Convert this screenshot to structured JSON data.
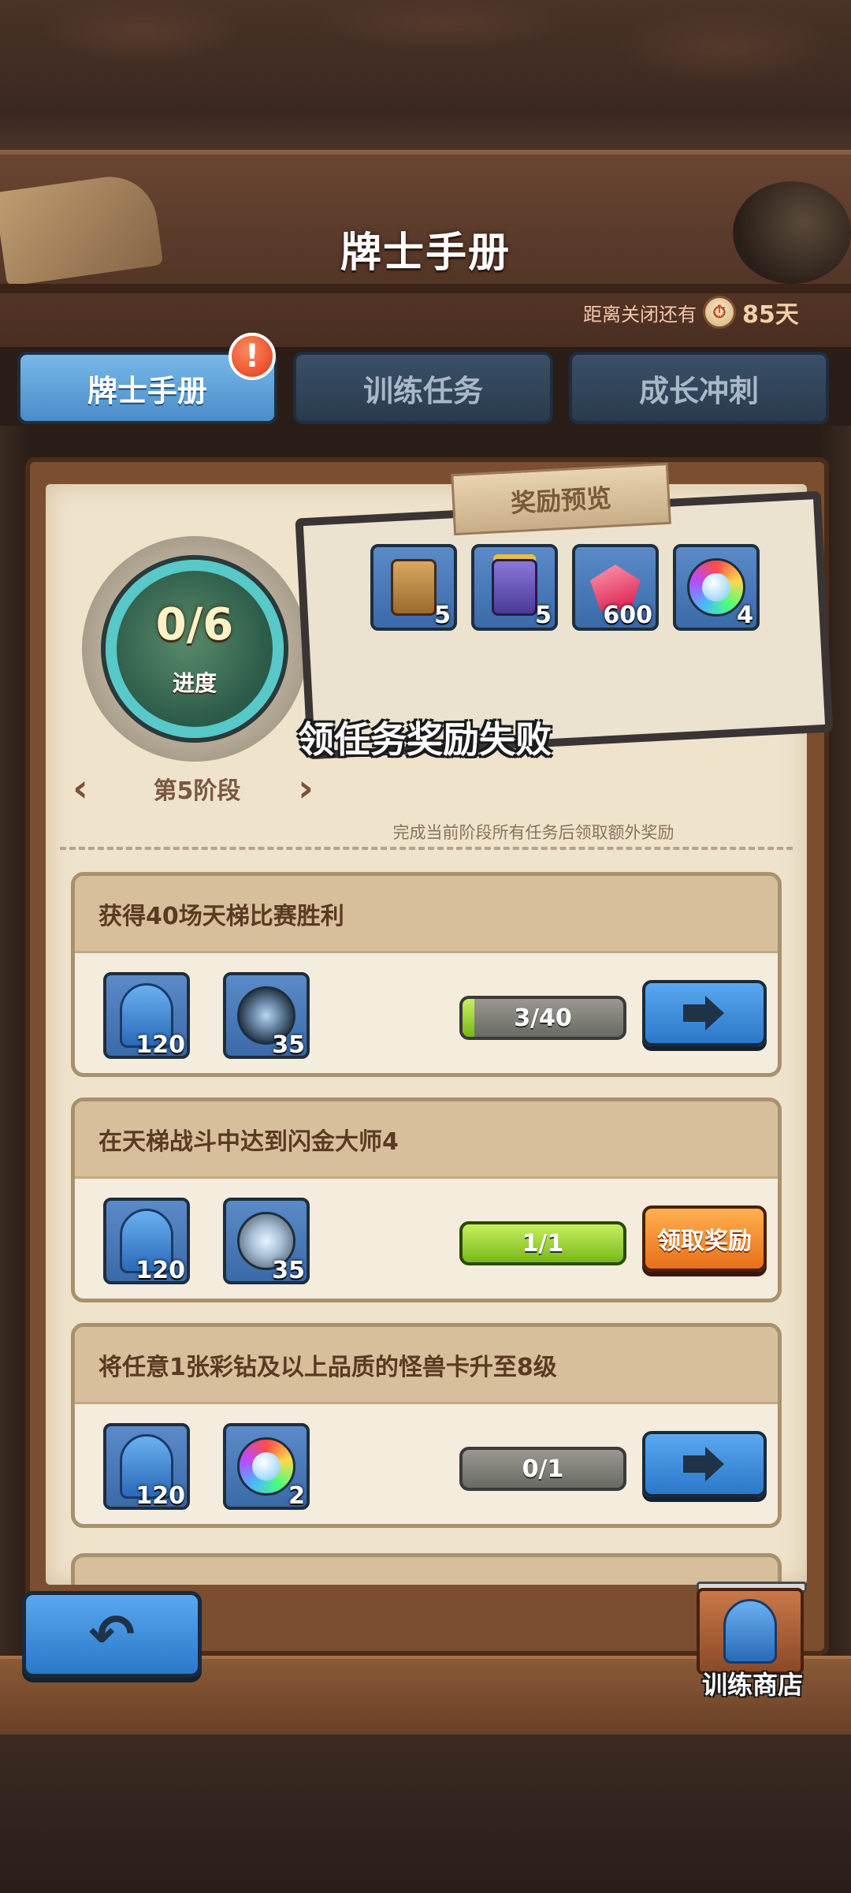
{
  "header": {
    "title": "牌士手册",
    "countdown_label": "距离关闭还有",
    "countdown_value": "85天"
  },
  "tabs": [
    {
      "label": "牌士手册",
      "active": true,
      "alert": "!"
    },
    {
      "label": "训练任务",
      "active": false
    },
    {
      "label": "成长冲刺",
      "active": false
    }
  ],
  "stage": {
    "progress": "0/6",
    "progress_label": "进度",
    "stage_label": "第5阶段",
    "prev_icon": "chevron-left-icon",
    "next_icon": "chevron-right-icon"
  },
  "reward_preview": {
    "title": "奖励预览",
    "items": [
      {
        "icon": "gold-chest-icon",
        "qty": "5"
      },
      {
        "icon": "purple-chest-icon",
        "qty": "5"
      },
      {
        "icon": "red-gem-icon",
        "qty": "600"
      },
      {
        "icon": "rainbow-orb-icon",
        "qty": "4"
      }
    ],
    "toast": "领任务奖励失败",
    "note": "完成当前阶段所有任务后领取额外奖励"
  },
  "tasks": [
    {
      "title": "获得40场天梯比赛胜利",
      "rewards": [
        {
          "icon": "hero-token-icon",
          "qty": "120"
        },
        {
          "icon": "dark-orb-icon",
          "qty": "35"
        }
      ],
      "progress_text": "3/40",
      "progress_fraction": 0.075,
      "action": "go"
    },
    {
      "title": "在天梯战斗中达到闪金大师4",
      "rewards": [
        {
          "icon": "hero-token-icon",
          "qty": "120"
        },
        {
          "icon": "silver-orb-icon",
          "qty": "35"
        }
      ],
      "progress_text": "1/1",
      "progress_fraction": 1.0,
      "action": "claim",
      "action_label": "领取奖励"
    },
    {
      "title": "将任意1张彩钻及以上品质的怪兽卡升至8级",
      "rewards": [
        {
          "icon": "hero-token-icon",
          "qty": "120"
        },
        {
          "icon": "rainbow-orb-icon",
          "qty": "2"
        }
      ],
      "progress_text": "0/1",
      "progress_fraction": 0.0,
      "action": "go"
    }
  ],
  "footer": {
    "back_icon": "back-arrow-icon",
    "back_symbol": "↶",
    "shop_label": "训练商店"
  },
  "colors": {
    "tab_active": "#4a8cc8",
    "tab_inactive": "#2a3a4c",
    "claim_button": "#e8701a",
    "progress_fill": "#78b818",
    "parchment": "#efe3cc"
  }
}
